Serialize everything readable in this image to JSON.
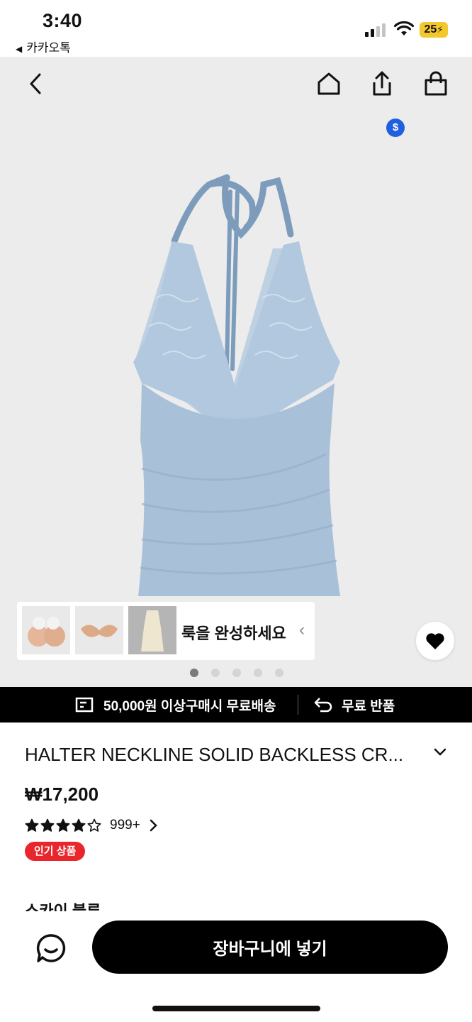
{
  "status_bar": {
    "time": "3:40",
    "back_app": "카카오톡",
    "battery": "25"
  },
  "nav": {
    "cart_badge": "$"
  },
  "complete_look": {
    "label": "룩을 완성하세요"
  },
  "carousel": {
    "total": 5,
    "active": 0
  },
  "promo": {
    "shipping": "50,000원 이상구매시 무료배송",
    "returns": "무료 반품"
  },
  "product": {
    "title": "HALTER NECKLINE SOLID BACKLESS CR...",
    "price": "₩17,200",
    "rating": 4,
    "rating_max": 5,
    "review_count": "999+",
    "badge": "인기 상품",
    "color_label": "스카이 블루"
  },
  "actions": {
    "add_to_cart": "장바구니에 넣기"
  },
  "colors": {
    "product": "#a9c1d8",
    "badge": "#e8262c",
    "cart_badge": "#1f5fe0"
  }
}
